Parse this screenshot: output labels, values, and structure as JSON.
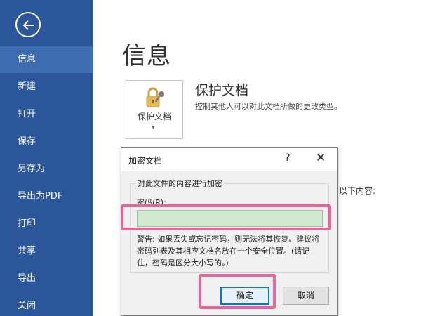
{
  "sidebar": {
    "back_icon": "back-arrow-icon",
    "items": [
      {
        "label": "信息",
        "active": true
      },
      {
        "label": "新建"
      },
      {
        "label": "打开"
      },
      {
        "label": "保存"
      },
      {
        "label": "另存为"
      },
      {
        "label": "导出为PDF"
      },
      {
        "label": "打印"
      },
      {
        "label": "共享"
      },
      {
        "label": "导出"
      },
      {
        "label": "关闭"
      }
    ],
    "bg_color": "#2b579a"
  },
  "main": {
    "title": "信息",
    "protect": {
      "button_label": "保护文档",
      "icon": "lock-key-icon",
      "section_title": "保护文档",
      "section_desc": "控制其他人可以对此文档所做的更改类型。"
    },
    "partial_text": "以下内容:"
  },
  "dialog": {
    "title": "加密文档",
    "help": "?",
    "close": "✕",
    "group_label": "对此文件的内容进行加密",
    "password_label": "密码(R):",
    "password_value": "",
    "warning": "警告: 如果丢失或忘记密码，则无法将其恢复。建议将密码列表及其相应文档名放在一个安全位置。(请记住，密码是区分大小写的。)",
    "ok_label": "确定",
    "cancel_label": "取消"
  },
  "highlight_color": "#e8659a"
}
